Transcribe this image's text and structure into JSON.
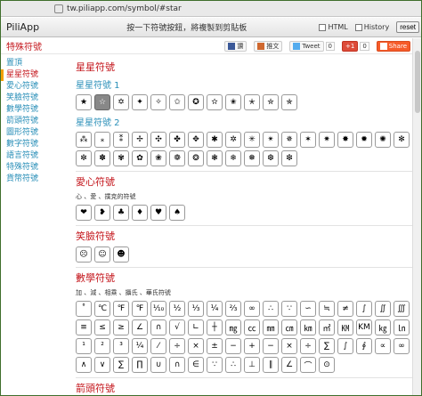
{
  "browser": {
    "url": "tw.piliapp.com/symbol/#star"
  },
  "toolbar": {
    "brand": "PiliApp",
    "hint": "按一下符號按鈕，將複製到剪貼板",
    "html_label": "HTML",
    "history_label": "History",
    "reset_label": "reset"
  },
  "section_title": "特殊符號",
  "social": {
    "fb": "讚",
    "plurk": "推文",
    "tweet": "Tweet",
    "tweet_count": "0",
    "gplus": "+1",
    "gplus_count": "0",
    "share": "Share"
  },
  "sidebar": {
    "items": [
      {
        "label": "置頂"
      },
      {
        "label": "星星符號"
      },
      {
        "label": "愛心符號"
      },
      {
        "label": "笑臉符號"
      },
      {
        "label": "數學符號"
      },
      {
        "label": "箭頭符號"
      },
      {
        "label": "圖形符號"
      },
      {
        "label": "數字符號"
      },
      {
        "label": "語言符號"
      },
      {
        "label": "特殊符號"
      },
      {
        "label": "貨幣符號"
      }
    ]
  },
  "main": {
    "star_title": "星星符號",
    "star1_sub": "星星符號 1",
    "star1": [
      "★",
      "☆",
      "✡",
      "✦",
      "✧",
      "✩",
      "✪",
      "✫",
      "✬",
      "✭",
      "✮",
      "✯"
    ],
    "star2_sub": "星星符號 2",
    "star2": [
      "⁂",
      "⁎",
      "⁑",
      "✢",
      "✣",
      "✤",
      "✥",
      "✱",
      "✲",
      "✳",
      "✴",
      "✵",
      "✶",
      "✷",
      "✸",
      "✹",
      "✺",
      "✻",
      "✼",
      "✽",
      "✾",
      "✿",
      "❀",
      "❁",
      "❂",
      "❃",
      "❄",
      "❅",
      "❆",
      "❇"
    ],
    "heart_title": "愛心符號",
    "heart_desc": "心 、愛 、撲克的符號",
    "hearts": [
      "❤",
      "❥",
      "♣",
      "♦",
      "♥",
      "♠"
    ],
    "smile_title": "笑臉符號",
    "smiles": [
      "☹",
      "☺",
      "☻"
    ],
    "math_title": "數學符號",
    "math_desc": "加 、減 、相乘 、攝氏 、華氏符號",
    "math": [
      "˚",
      "℃",
      "℉",
      "℉",
      "⅒",
      "½",
      "⅓",
      "¼",
      "⅔",
      "∞",
      "∴",
      "∵",
      "∽",
      "≒",
      "≠",
      "∫",
      "∬",
      "∭",
      "≡",
      "≤",
      "≥",
      "∠",
      "∩",
      "√",
      "∟",
      "┼",
      "㎎",
      "㏄",
      "㎜",
      "㎝",
      "㎞",
      "㎡",
      "㏎",
      "KM",
      "㎏",
      "㏑",
      "¹",
      "²",
      "³",
      "¼",
      "⁄",
      "÷",
      "×",
      "±",
      "−",
      "+",
      "−",
      "×",
      "÷",
      "∑",
      "∫",
      "∮",
      "∝",
      "∞",
      "∧",
      "∨",
      "∑",
      "∏",
      "∪",
      "∩",
      "∈",
      "∵",
      "∴",
      "⊥",
      "∥",
      "∠",
      "⌒",
      "⊙"
    ],
    "arrow_title": "箭頭符號"
  }
}
